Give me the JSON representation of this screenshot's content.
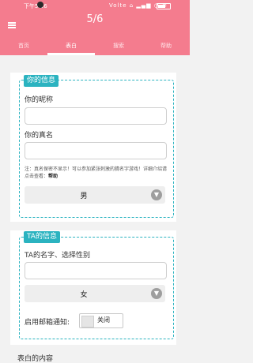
{
  "status_bar": {
    "time": "下午5:36",
    "right": "Volte ⌂ ▂▄▆ ◔ ≋"
  },
  "header": {
    "page_counter": "5/6"
  },
  "tabs": [
    {
      "label": "首页"
    },
    {
      "label": "表白"
    },
    {
      "label": "搜索"
    },
    {
      "label": "帮助"
    }
  ],
  "your_info": {
    "section_label": "你的信息",
    "nickname_label": "你的昵称",
    "real_name_label": "你的真名",
    "note_text": "注：真名保密不显示！可以参加紧张刺激的猜名字游戏！详细介绍请点击查看：",
    "note_link": "帮助",
    "gender_value": "男"
  },
  "ta_info": {
    "section_label": "TA的信息",
    "name_gender_label": "TA的名字、选择性别",
    "gender_value": "女",
    "email_notify_label": "启用邮箱通知:",
    "email_toggle_text": "关闭"
  },
  "confession": {
    "content_label": "表白的内容"
  }
}
